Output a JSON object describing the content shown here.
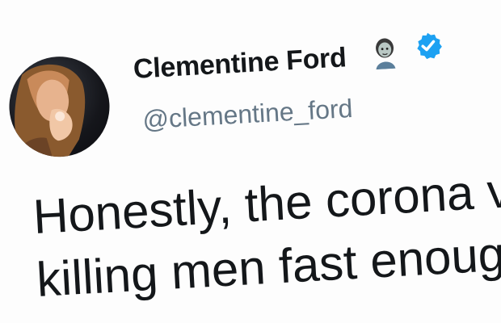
{
  "tweet": {
    "display_name": "Clementine Ford",
    "handle": "@clementine_ford",
    "emoji_icon": "zombie-woman-emoji-icon",
    "verified_icon": "verified-badge-icon",
    "verified_color": "#1da1f2",
    "text_lines": [
      "Honestly, the corona viru",
      "killing men fast enough."
    ]
  }
}
